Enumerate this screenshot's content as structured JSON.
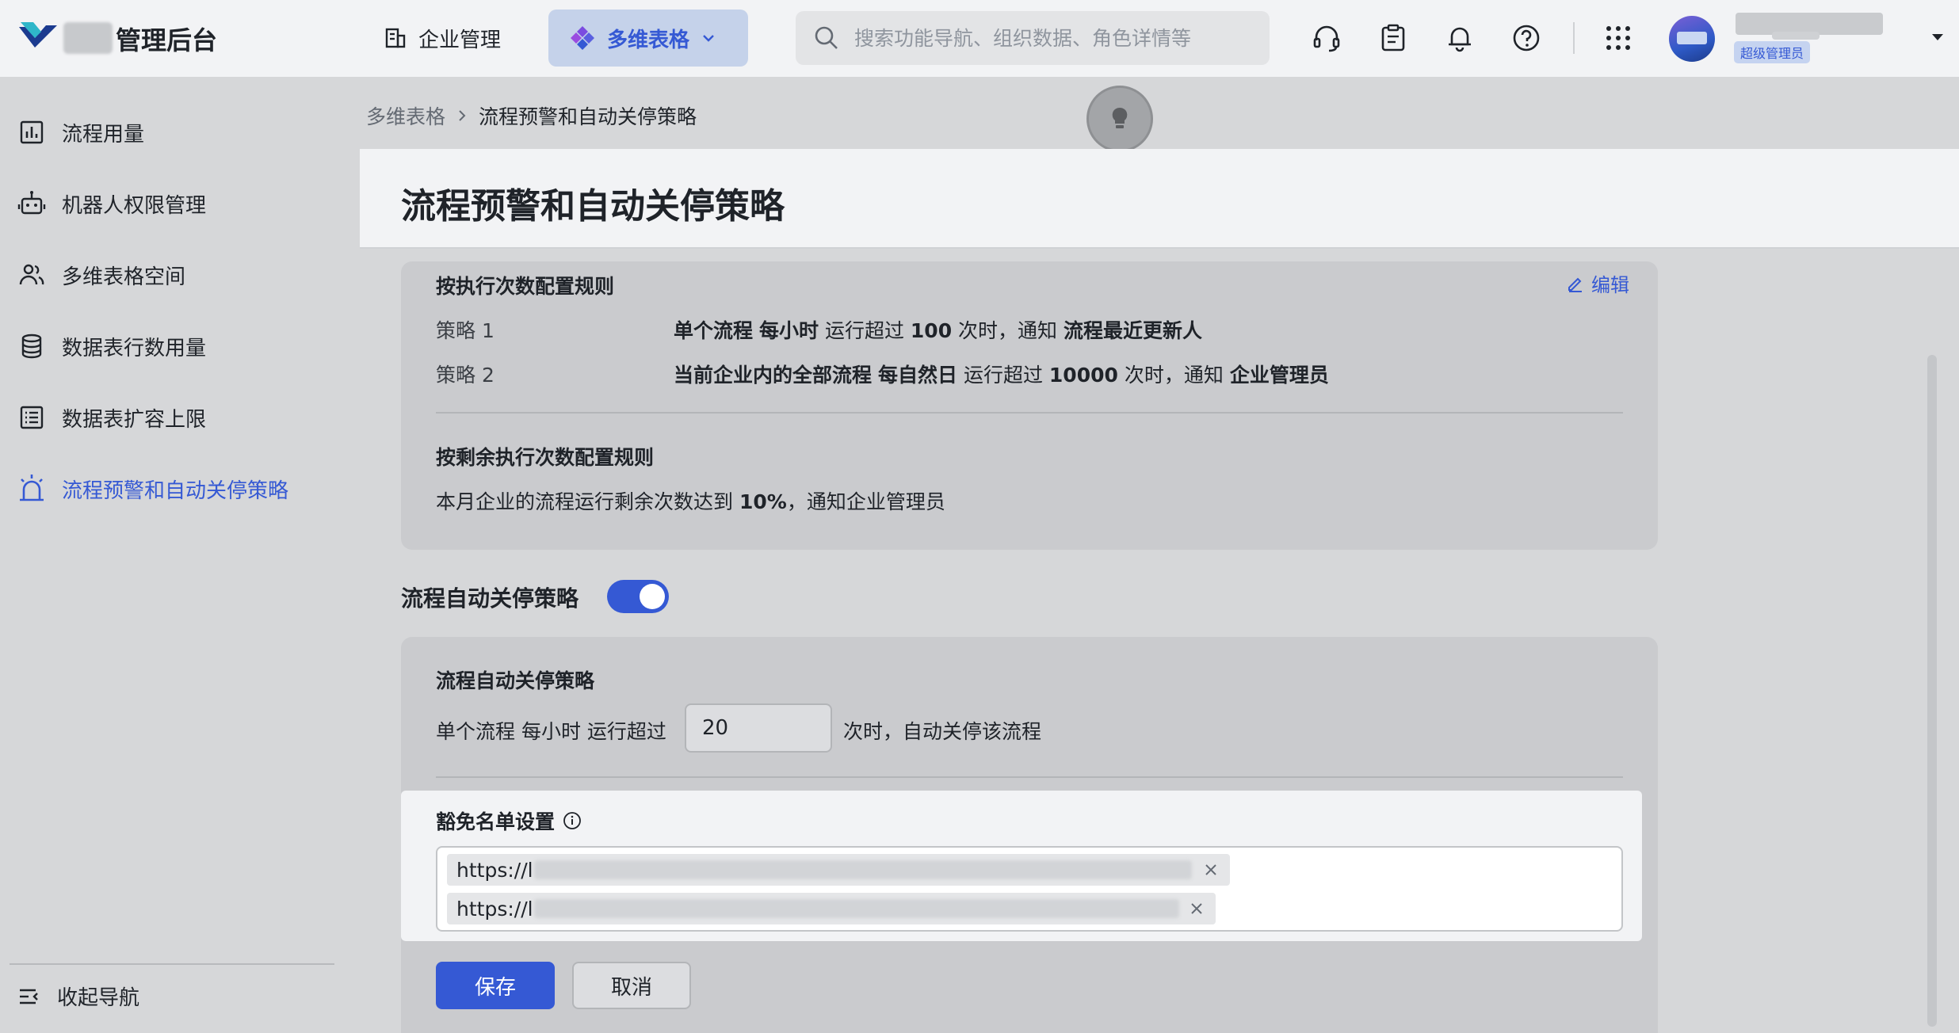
{
  "app": {
    "brand": "管理后台"
  },
  "topnav": {
    "enterprise": "企业管理",
    "active_product": "多维表格",
    "search_placeholder": "搜索功能导航、组织数据、角色详情等"
  },
  "user": {
    "role_badge": "超级管理员"
  },
  "sidebar": {
    "items": [
      {
        "label": "流程用量",
        "icon": "bar-chart-icon"
      },
      {
        "label": "机器人权限管理",
        "icon": "robot-icon"
      },
      {
        "label": "多维表格空间",
        "icon": "users-icon"
      },
      {
        "label": "数据表行数用量",
        "icon": "database-icon"
      },
      {
        "label": "数据表扩容上限",
        "icon": "list-icon"
      },
      {
        "label": "流程预警和自动关停策略",
        "icon": "alarm-icon",
        "active": true
      }
    ],
    "collapse_label": "收起导航"
  },
  "breadcrumb": {
    "parent": "多维表格",
    "current": "流程预警和自动关停策略"
  },
  "page": {
    "title": "流程预警和自动关停策略"
  },
  "exec_rules": {
    "title": "按执行次数配置规则",
    "edit_label": "编辑",
    "rules": [
      {
        "label": "策略 1",
        "scope": "单个流程",
        "period": "每小时",
        "mid": "运行超过",
        "count": "100",
        "suffix": "次时，通知",
        "notify": "流程最近更新人"
      },
      {
        "label": "策略 2",
        "scope": "当前企业内的全部流程",
        "period": "每自然日",
        "mid": "运行超过",
        "count": "10000",
        "suffix": "次时，通知",
        "notify": "企业管理员"
      }
    ]
  },
  "remaining_rules": {
    "title": "按剩余执行次数配置规则",
    "text_before": "本月企业的流程运行剩余次数达到",
    "percent": "10%",
    "text_after": "，通知企业管理员"
  },
  "auto_stop": {
    "toggle_label": "流程自动关停策略",
    "enabled": true,
    "card_title": "流程自动关停策略",
    "text_before": "单个流程 每小时 运行超过",
    "threshold": "20",
    "text_after": "次时，自动关停该流程"
  },
  "whitelist": {
    "title": "豁免名单设置",
    "tags": [
      "https://l",
      "https://l"
    ]
  },
  "actions": {
    "save": "保存",
    "cancel": "取消"
  },
  "colors": {
    "accent": "#3559d4",
    "topbar_bg": "#f2f3f5",
    "page_bg": "#d6d7d9",
    "card_bg": "#cacbce"
  }
}
